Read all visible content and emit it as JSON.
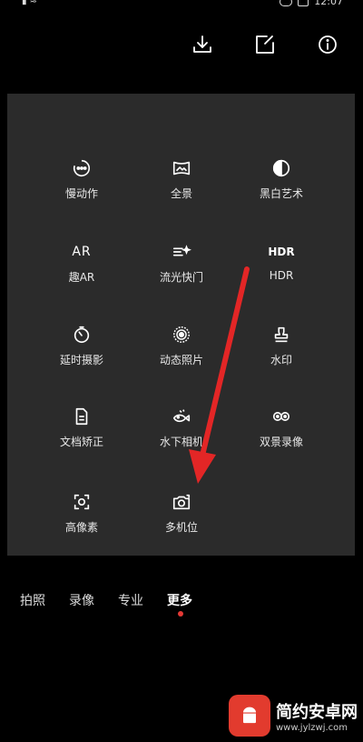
{
  "status_bar": {
    "time": "12:07"
  },
  "toolbar": {
    "icons": [
      "download-icon",
      "edit-icon",
      "info-icon"
    ]
  },
  "modes": [
    {
      "label": "慢动作",
      "icon": "slow-motion-icon"
    },
    {
      "label": "全景",
      "icon": "panorama-icon"
    },
    {
      "label": "黑白艺术",
      "icon": "monochrome-icon"
    },
    {
      "label": "趣AR",
      "icon": "ar-icon"
    },
    {
      "label": "流光快门",
      "icon": "light-painting-icon"
    },
    {
      "label": "HDR",
      "icon": "hdr-icon"
    },
    {
      "label": "延时摄影",
      "icon": "timelapse-icon"
    },
    {
      "label": "动态照片",
      "icon": "moving-picture-icon"
    },
    {
      "label": "水印",
      "icon": "watermark-stamp-icon"
    },
    {
      "label": "文档矫正",
      "icon": "document-icon"
    },
    {
      "label": "水下相机",
      "icon": "underwater-fish-icon"
    },
    {
      "label": "双景录像",
      "icon": "dual-view-icon"
    },
    {
      "label": "高像素",
      "icon": "high-res-icon"
    },
    {
      "label": "多机位",
      "icon": "multi-camera-icon"
    }
  ],
  "hdr_icon_text": "HDR",
  "ar_icon_text": "AR",
  "tabs": [
    {
      "label": "拍照"
    },
    {
      "label": "录像"
    },
    {
      "label": "专业"
    },
    {
      "label": "更多",
      "active": true
    }
  ],
  "watermark": {
    "title": "简约安卓网",
    "url": "www.jylzwj.com"
  },
  "colors": {
    "panel": "#2b2b2b",
    "accent_red": "#e53935"
  }
}
